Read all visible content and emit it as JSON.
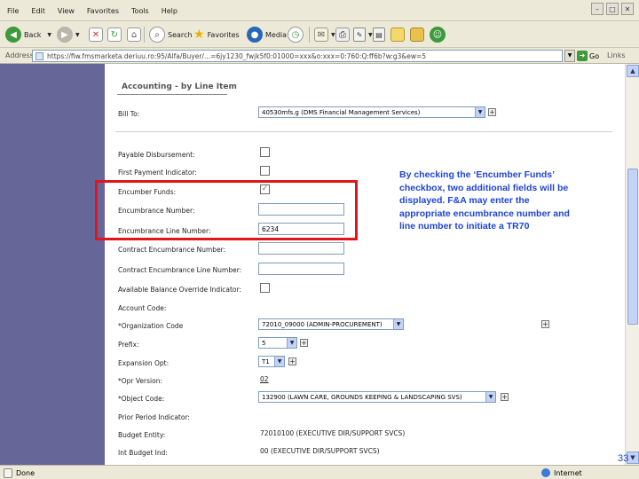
{
  "menus": [
    "File",
    "Edit",
    "View",
    "Favorites",
    "Tools",
    "Help"
  ],
  "toolbar": {
    "back": "Back",
    "search": "Search",
    "favorites": "Favorites",
    "media": "Media"
  },
  "address": {
    "label": "Address",
    "value": "https://fiw.fmsmarketa.deriuu.ro:95/Alfa/Buyer/...=6jy1230_fwjk5f0:01000=xxx&o:xxx=0:760:Q:ff6b?w:g3&ew=5",
    "go": "Go",
    "links": "Links"
  },
  "section_title": "Accounting - by Line Item",
  "form": {
    "bill_to": {
      "label": "Bill To:",
      "value": "40530mfs.g (DMS Financial Management Services)"
    },
    "payable_disbursement": "Payable Disbursement:",
    "first_payment_indicator": "First Payment Indicator:",
    "encumber_funds": {
      "label": "Encumber Funds:",
      "checked": true
    },
    "encumbrance_number": {
      "label": "Encumbrance Number:",
      "value": ""
    },
    "encumbrance_line_number": {
      "label": "Encumbrance Line Number:",
      "value": "6234"
    },
    "contract_encumbrance_number": {
      "label": "Contract Encumbrance Number:",
      "value": ""
    },
    "contract_encumbrance_line_number": {
      "label": "Contract Encumbrance Line Number:",
      "value": ""
    },
    "available_balance_override": "Available Balance Override Indicator:",
    "account_code": "Account Code:",
    "organization_code": {
      "label": "*Organization Code",
      "value": "72010_09000 (ADMIN-PROCUREMENT)"
    },
    "prefix": {
      "label": "Prefix:",
      "value": "5"
    },
    "expansion_opt": {
      "label": "Expansion Opt:",
      "value": "T1"
    },
    "opr_version": {
      "label": "*Opr Version:",
      "value": "02"
    },
    "object_code": {
      "label": "*Object Code:",
      "value": "132900 (LAWN CARE, GROUNDS KEEPING & LANDSCAPING SVS)"
    },
    "prior_period_indicator": "Prior Period Indicator:",
    "budget_entity": {
      "label": "Budget Entity:",
      "value": "72010100 (EXECUTIVE DIR/SUPPORT SVCS)"
    },
    "int_budget_ind": {
      "label": "Int Budget Ind:",
      "value": "00 (EXECUTIVE DIR/SUPPORT SVCS)"
    }
  },
  "callout": "By checking the ‘Encumber Funds’ checkbox, two additional fields will be displayed.  F&A may enter the appropriate encumbrance number and line number to initiate a TR70",
  "status": {
    "left": "Done",
    "right": "Internet"
  },
  "page_number": "33",
  "colors": {
    "sidebar": "#666699",
    "callout": "#1f44d3",
    "highlight": "#e0161c"
  }
}
